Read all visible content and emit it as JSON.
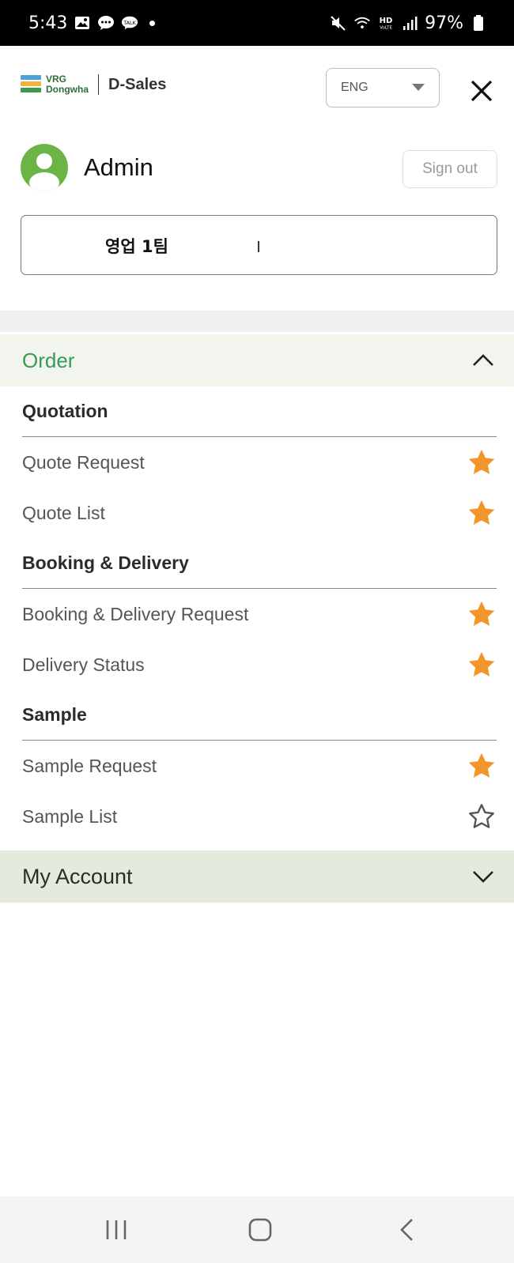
{
  "status_bar": {
    "time": "5:43",
    "battery": "97%",
    "icons": [
      "gallery-icon",
      "message-icon",
      "talk-icon",
      "mute-icon",
      "wifi-icon",
      "hd-voice-icon",
      "signal-icon",
      "battery-icon"
    ]
  },
  "header": {
    "brand_line1": "VRG",
    "brand_line2": "Dongwha",
    "app_name": "D-Sales",
    "language": "ENG"
  },
  "profile": {
    "name": "Admin",
    "sign_out": "Sign out",
    "team": "영업 1팀"
  },
  "menu": {
    "order": {
      "title": "Order",
      "sections": [
        {
          "title": "Quotation",
          "items": [
            {
              "label": "Quote Request",
              "favorite": true
            },
            {
              "label": "Quote List",
              "favorite": true
            }
          ]
        },
        {
          "title": "Booking & Delivery",
          "items": [
            {
              "label": "Booking & Delivery Request",
              "favorite": true
            },
            {
              "label": "Delivery Status",
              "favorite": true
            }
          ]
        },
        {
          "title": "Sample",
          "items": [
            {
              "label": "Sample Request",
              "favorite": true
            },
            {
              "label": "Sample List",
              "favorite": false
            }
          ]
        }
      ]
    },
    "account": {
      "title": "My Account"
    }
  },
  "colors": {
    "accent_green": "#3a9a55",
    "star_orange": "#f2962c",
    "avatar_green": "#6bb546"
  }
}
